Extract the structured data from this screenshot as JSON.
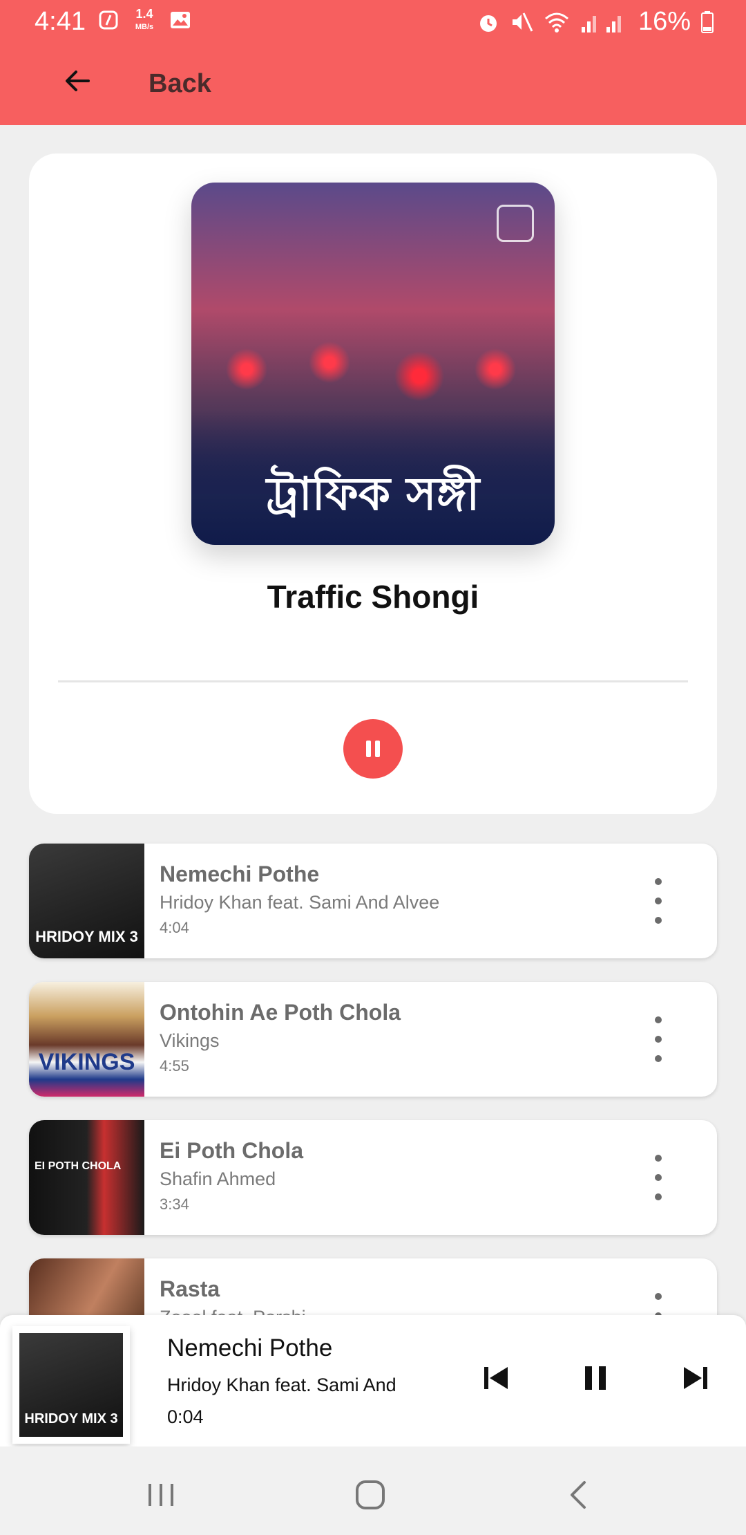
{
  "status_bar": {
    "time": "4:41",
    "speed_value": "1.4",
    "speed_unit": "MB/s",
    "battery": "16%",
    "icons": [
      "data-saver-icon",
      "image-icon",
      "alarm-icon",
      "mute-icon",
      "wifi-icon",
      "signal-icon",
      "battery-icon"
    ]
  },
  "app_bar": {
    "back_label": "Back",
    "color": "#f75f5f"
  },
  "now_playing": {
    "cover_text": "ট্রাফিক সঙ্গী",
    "title": "Traffic Shongi",
    "progress": 0.0,
    "play_button_color": "#f44f4f",
    "state_icon": "pause-icon"
  },
  "tracks": [
    {
      "title": "Nemechi Pothe",
      "artist": "Hridoy Khan feat. Sami And Alvee",
      "duration": "4:04",
      "thumb_text": "HRIDOY MIX 3"
    },
    {
      "title": "Ontohin Ae Poth Chola",
      "artist": "Vikings",
      "duration": "4:55",
      "thumb_text": "VIKINGS"
    },
    {
      "title": "Ei Poth Chola",
      "artist": "Shafin Ahmed",
      "duration": "3:34",
      "thumb_text": "EI POTH CHOLA"
    },
    {
      "title": "Rasta",
      "artist": "Zooel feat. Porshi",
      "duration": "",
      "thumb_text": ""
    }
  ],
  "mini_player": {
    "title": "Nemechi Pothe",
    "artist": "Hridoy Khan feat. Sami And",
    "time": "0:04",
    "thumb_text": "HRIDOY MIX 3"
  }
}
